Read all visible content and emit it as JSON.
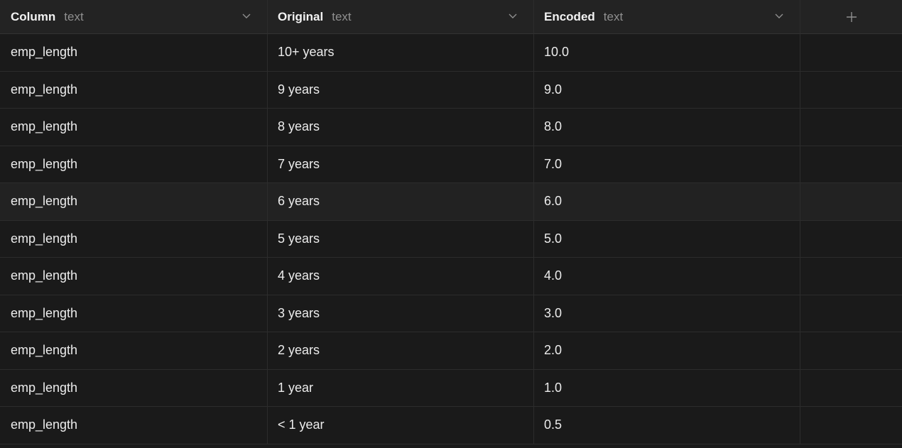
{
  "columns": [
    {
      "name": "Column",
      "type": "text"
    },
    {
      "name": "Original",
      "type": "text"
    },
    {
      "name": "Encoded",
      "type": "text"
    }
  ],
  "icons": {
    "sort": "chevron-down-icon",
    "add": "plus-icon"
  },
  "rows": [
    {
      "column": "emp_length",
      "original": "10+ years",
      "encoded": "10.0"
    },
    {
      "column": "emp_length",
      "original": "9 years",
      "encoded": "9.0"
    },
    {
      "column": "emp_length",
      "original": "8 years",
      "encoded": "8.0"
    },
    {
      "column": "emp_length",
      "original": "7 years",
      "encoded": "7.0"
    },
    {
      "column": "emp_length",
      "original": "6 years",
      "encoded": "6.0"
    },
    {
      "column": "emp_length",
      "original": "5 years",
      "encoded": "5.0"
    },
    {
      "column": "emp_length",
      "original": "4 years",
      "encoded": "4.0"
    },
    {
      "column": "emp_length",
      "original": "3 years",
      "encoded": "3.0"
    },
    {
      "column": "emp_length",
      "original": "2 years",
      "encoded": "2.0"
    },
    {
      "column": "emp_length",
      "original": "1 year",
      "encoded": "1.0"
    },
    {
      "column": "emp_length",
      "original": "< 1 year",
      "encoded": "0.5"
    }
  ],
  "highlighted_row": 4,
  "colors": {
    "background": "#1a1a1a",
    "header": "#232323",
    "highlight": "#222222",
    "text": "#ececec",
    "muted": "#8f8f8f"
  }
}
